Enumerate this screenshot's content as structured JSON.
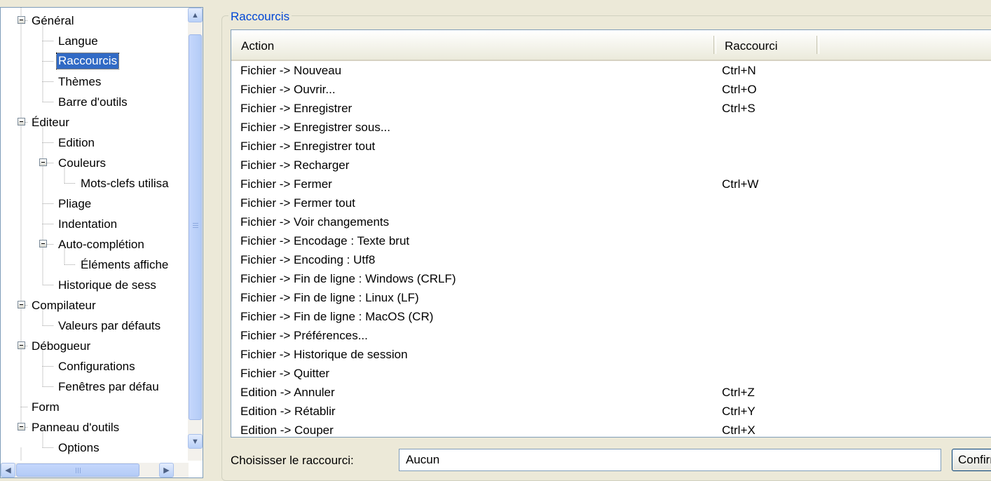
{
  "tree": {
    "items": [
      {
        "label": "Général",
        "level": 0,
        "expandable": true
      },
      {
        "label": "Langue",
        "level": 1
      },
      {
        "label": "Raccourcis",
        "level": 1,
        "selected": true
      },
      {
        "label": "Thèmes",
        "level": 1
      },
      {
        "label": "Barre d'outils",
        "level": 1
      },
      {
        "label": "Éditeur",
        "level": 0,
        "expandable": true
      },
      {
        "label": "Edition",
        "level": 1
      },
      {
        "label": "Couleurs",
        "level": 1,
        "expandable": true
      },
      {
        "label": "Mots-clefs utilisa",
        "level": 2
      },
      {
        "label": "Pliage",
        "level": 1
      },
      {
        "label": "Indentation",
        "level": 1
      },
      {
        "label": "Auto-complétion",
        "level": 1,
        "expandable": true
      },
      {
        "label": "Éléments affiche",
        "level": 2
      },
      {
        "label": "Historique de sess",
        "level": 1
      },
      {
        "label": "Compilateur",
        "level": 0,
        "expandable": true
      },
      {
        "label": "Valeurs par défauts",
        "level": 1
      },
      {
        "label": "Débogueur",
        "level": 0,
        "expandable": true
      },
      {
        "label": "Configurations",
        "level": 1
      },
      {
        "label": "Fenêtres par défau",
        "level": 1
      },
      {
        "label": "Form",
        "level": 0
      },
      {
        "label": "Panneau d'outils",
        "level": 0,
        "expandable": true
      },
      {
        "label": "Options",
        "level": 1
      }
    ]
  },
  "group": {
    "title": "Raccourcis"
  },
  "table": {
    "columns": [
      "Action",
      "Raccourci"
    ],
    "rows": [
      [
        "Fichier -> Nouveau",
        "Ctrl+N"
      ],
      [
        "Fichier -> Ouvrir...",
        "Ctrl+O"
      ],
      [
        "Fichier -> Enregistrer",
        "Ctrl+S"
      ],
      [
        "Fichier -> Enregistrer sous...",
        ""
      ],
      [
        "Fichier -> Enregistrer tout",
        ""
      ],
      [
        "Fichier -> Recharger",
        ""
      ],
      [
        "Fichier -> Fermer",
        "Ctrl+W"
      ],
      [
        "Fichier -> Fermer tout",
        ""
      ],
      [
        "Fichier -> Voir changements",
        ""
      ],
      [
        "Fichier -> Encodage : Texte brut",
        ""
      ],
      [
        "Fichier -> Encoding : Utf8",
        ""
      ],
      [
        "Fichier -> Fin de ligne : Windows (CRLF)",
        ""
      ],
      [
        "Fichier -> Fin de ligne : Linux (LF)",
        ""
      ],
      [
        "Fichier -> Fin de ligne : MacOS (CR)",
        ""
      ],
      [
        "Fichier -> Préférences...",
        ""
      ],
      [
        "Fichier -> Historique de session",
        ""
      ],
      [
        "Fichier -> Quitter",
        ""
      ],
      [
        "Edition -> Annuler",
        "Ctrl+Z"
      ],
      [
        "Edition -> Rétablir",
        "Ctrl+Y"
      ],
      [
        "Edition -> Couper",
        "Ctrl+X"
      ]
    ]
  },
  "shortcut": {
    "label": "Choisisser le raccourci:",
    "value": "Aucun",
    "button_label": "Confirmer"
  },
  "icons": {
    "scroll_up": "up-arrow-icon",
    "scroll_down": "down-arrow-icon",
    "scroll_left": "left-arrow-icon",
    "scroll_right": "right-arrow-icon"
  },
  "colors": {
    "selection": "#316AC5",
    "group_title": "#0046D5",
    "window_bg": "#ECE9D8"
  }
}
